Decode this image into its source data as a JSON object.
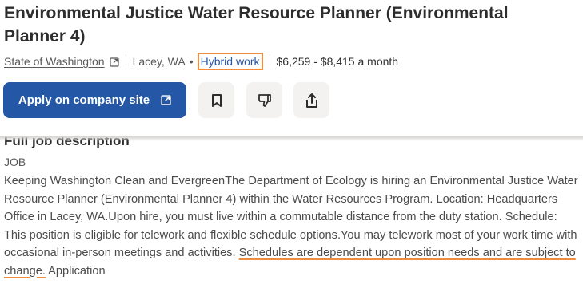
{
  "job": {
    "title": "Environmental Justice Water Resource Planner (Environmental Planner 4)",
    "company": "State of Washington",
    "location": "Lacey, WA",
    "work_type": "Hybrid work",
    "salary": "$6,259 - $8,415 a month"
  },
  "actions": {
    "apply_label": "Apply on company site",
    "apply_icon": "external-link-icon",
    "save_icon": "bookmark-icon",
    "not_interested_icon": "thumbs-down-icon",
    "share_icon": "share-icon"
  },
  "description": {
    "heading": "Full job description",
    "label": "JOB",
    "text_before": "Keeping Washington Clean and EvergreenThe Department of Ecology is hiring an Environmental Justice Water Resource Planner (Environmental Planner 4) within the Water Resources Program. Location: Headquarters Office in Lacey, WA.Upon hire, you must live within a commutable distance from the duty station. Schedule: This position is eligible for telework and flexible schedule options.You may telework most of your work time with occasional in-person meetings and activities. ",
    "highlighted": "Schedules are dependent upon position needs and are subject to change.",
    "text_after": " Application"
  },
  "colors": {
    "primary": "#2557a7",
    "highlight": "#f28c3a",
    "button_bg": "#f3f2f1"
  }
}
